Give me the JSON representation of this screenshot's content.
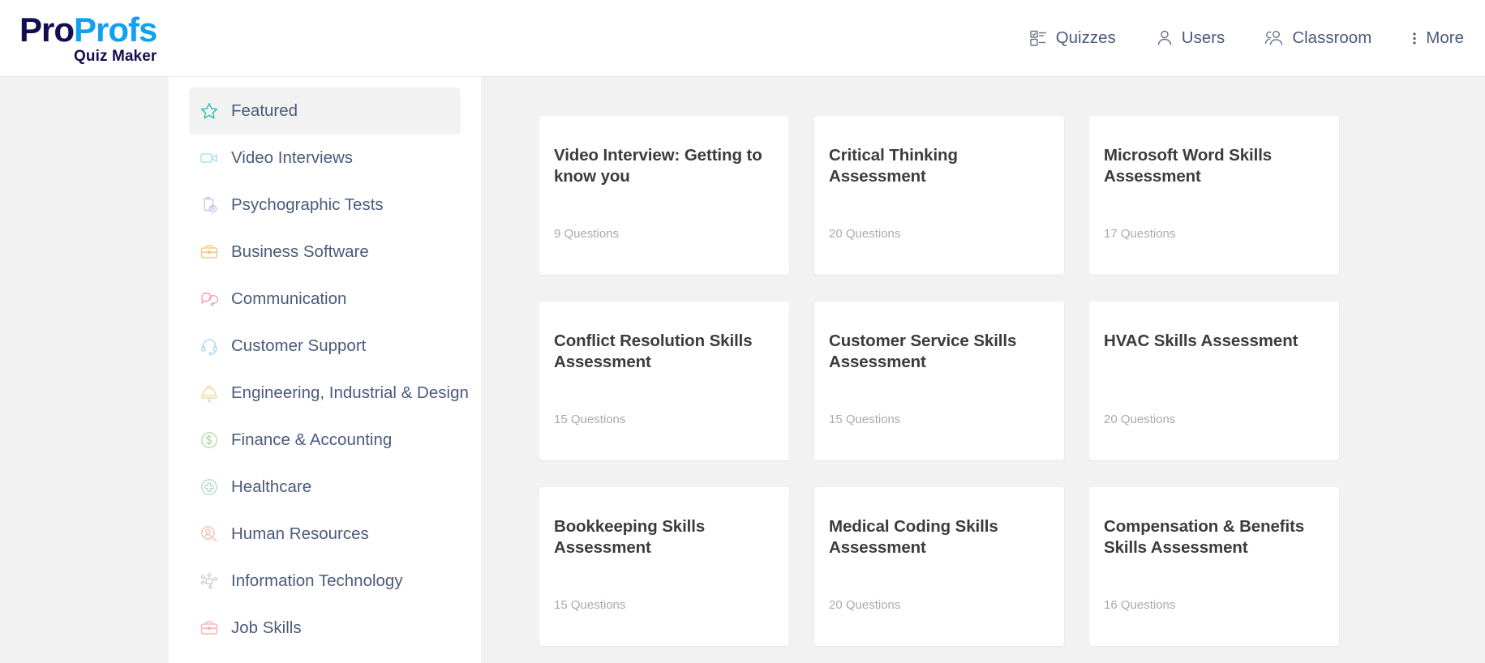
{
  "header": {
    "logo": {
      "part1": "Pro",
      "part2": "Profs",
      "subtitle": "Quiz Maker",
      "color_part1": "#130e4f",
      "color_part2": "#12a1f0"
    },
    "nav": [
      {
        "label": "Quizzes",
        "icon": "checklist-icon"
      },
      {
        "label": "Users",
        "icon": "user-icon"
      },
      {
        "label": "Classroom",
        "icon": "users-group-icon"
      },
      {
        "label": "More",
        "icon": "vertical-dots-icon"
      }
    ]
  },
  "sidebar": {
    "items": [
      {
        "label": "Featured",
        "icon": "star-icon",
        "color": "#35bdb2",
        "active": true
      },
      {
        "label": "Video Interviews",
        "icon": "video-camera-icon",
        "color": "#a5e4f5",
        "active": false
      },
      {
        "label": "Psychographic Tests",
        "icon": "clipboard-check-icon",
        "color": "#c5c3ee",
        "active": false
      },
      {
        "label": "Business Software",
        "icon": "briefcase-icon",
        "color": "#f5c98a",
        "active": false
      },
      {
        "label": "Communication",
        "icon": "chat-bubbles-icon",
        "color": "#f2a0b4",
        "active": false
      },
      {
        "label": "Customer Support",
        "icon": "headset-icon",
        "color": "#aed8f2",
        "active": false
      },
      {
        "label": "Engineering, Industrial & Design",
        "icon": "hard-hat-icon",
        "color": "#f3d9a6",
        "active": false
      },
      {
        "label": "Finance & Accounting",
        "icon": "dollar-circle-icon",
        "color": "#b6ddaa",
        "active": false
      },
      {
        "label": "Healthcare",
        "icon": "medical-cross-icon",
        "color": "#b2e0c4",
        "active": false
      },
      {
        "label": "Human Resources",
        "icon": "person-search-icon",
        "color": "#f8c0ae",
        "active": false
      },
      {
        "label": "Information Technology",
        "icon": "network-nodes-icon",
        "color": "#c9cfd8",
        "active": false
      },
      {
        "label": "Job Skills",
        "icon": "briefcase-icon",
        "color": "#f6b9b9",
        "active": false
      }
    ]
  },
  "main": {
    "cards": [
      {
        "title": "Video Interview: Getting to know you",
        "questions": "9 Questions"
      },
      {
        "title": "Critical Thinking Assessment",
        "questions": "20 Questions"
      },
      {
        "title": "Microsoft Word Skills Assessment",
        "questions": "17 Questions"
      },
      {
        "title": "Conflict Resolution Skills Assessment",
        "questions": "15 Questions"
      },
      {
        "title": "Customer Service Skills Assessment",
        "questions": "15 Questions"
      },
      {
        "title": "HVAC Skills Assessment",
        "questions": "20 Questions"
      },
      {
        "title": "Bookkeeping Skills Assessment",
        "questions": "15 Questions"
      },
      {
        "title": "Medical Coding Skills Assessment",
        "questions": "20 Questions"
      },
      {
        "title": "Compensation & Benefits Skills Assessment",
        "questions": "16 Questions"
      }
    ]
  }
}
